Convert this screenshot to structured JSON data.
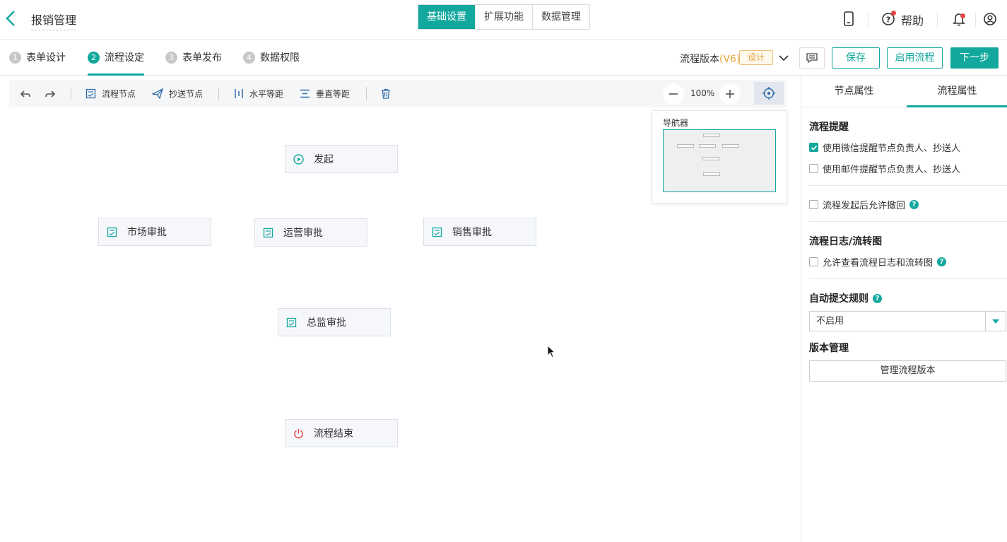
{
  "header": {
    "title": "报销管理",
    "tabs": [
      "基础设置",
      "扩展功能",
      "数据管理"
    ],
    "help_label": "帮助",
    "icons": [
      "back-chevron-icon",
      "mobile-icon",
      "help-icon",
      "bell-icon",
      "user-icon"
    ]
  },
  "steps": [
    {
      "num": "1",
      "label": "表单设计"
    },
    {
      "num": "2",
      "label": "流程设定"
    },
    {
      "num": "3",
      "label": "表单发布"
    },
    {
      "num": "4",
      "label": "数据权限"
    }
  ],
  "version": {
    "prefix": "流程版本",
    "value": "(V6)",
    "tag": "设计"
  },
  "actions": {
    "save": "保存",
    "enable": "启用流程",
    "next": "下一步"
  },
  "toolbar": {
    "flow_node": "流程节点",
    "cc_node": "抄送节点",
    "h_spacing": "水平等距",
    "v_spacing": "垂直等距",
    "zoom": "100%"
  },
  "navigator": {
    "title": "导航器"
  },
  "nodes": {
    "start": "发起",
    "market": "市场审批",
    "ops": "运营审批",
    "sales": "销售审批",
    "director": "总监审批",
    "end": "流程结束"
  },
  "panel": {
    "tabs": [
      "节点属性",
      "流程属性"
    ],
    "remind_title": "流程提醒",
    "wechat_remind": "使用微信提醒节点负责人、抄送人",
    "wechat_checked": true,
    "email_remind": "使用邮件提醒节点负责人、抄送人",
    "email_checked": false,
    "allow_withdraw": "流程发起后允许撤回",
    "log_title": "流程日志/流转图",
    "allow_view_log": "允许查看流程日志和流转图",
    "auto_submit_title": "自动提交规则",
    "auto_submit_value": "不启用",
    "version_title": "版本管理",
    "manage_versions": "管理流程版本"
  },
  "colors": {
    "accent": "#13a89e",
    "version": "#e8a23c",
    "end_icon": "#e84545"
  }
}
